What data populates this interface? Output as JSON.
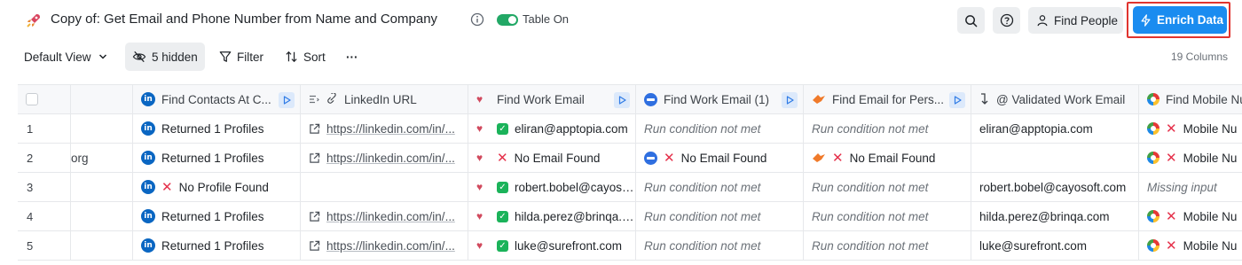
{
  "header": {
    "title": "Copy of: Get Email and Phone Number from Name and Company",
    "table_on_label": "Table On",
    "find_people_label": "Find People",
    "enrich_label": "Enrich Data"
  },
  "toolbar": {
    "view_label": "Default View",
    "hidden_label": "5 hidden",
    "filter_label": "Filter",
    "sort_label": "Sort",
    "more_label": "···",
    "column_count": "19 Columns"
  },
  "columns": [
    {
      "label": "",
      "icon": "checkbox"
    },
    {
      "label": "",
      "icon": ""
    },
    {
      "label": "Find Contacts At C...",
      "icon": "linkedin-icon"
    },
    {
      "label": "LinkedIn URL",
      "icon": "link-icon"
    },
    {
      "label": "Find Work Email",
      "icon": "heart-icon"
    },
    {
      "label": "Find Work Email (1)",
      "icon": "blue-dot-icon"
    },
    {
      "label": "Find Email for Pers...",
      "icon": "bird-icon"
    },
    {
      "label": "@ Validated Work Email",
      "icon": "return-arrow-icon"
    },
    {
      "label": "Find Mobile Nu",
      "icon": "gcolor-icon"
    }
  ],
  "rows": [
    {
      "num": "1",
      "col1": "",
      "contacts": "Returned 1 Profiles",
      "contacts_ok": true,
      "linkedin": "https://linkedin.com/in/...",
      "work_email": "eliran@apptopia.com",
      "work_email_ok": true,
      "work_email_1": "Run condition not met",
      "email_pers": "Run condition not met",
      "validated": "eliran@apptopia.com",
      "mobile": "Mobile Nu"
    },
    {
      "num": "2",
      "col1": "org",
      "contacts": "Returned 1 Profiles",
      "contacts_ok": true,
      "linkedin": "https://linkedin.com/in/...",
      "work_email": "No Email Found",
      "work_email_ok": false,
      "work_email_1": "No Email Found",
      "email_pers": "No Email Found",
      "validated": "",
      "mobile": "Mobile Nu"
    },
    {
      "num": "3",
      "col1": "",
      "contacts": "No Profile Found",
      "contacts_ok": false,
      "linkedin": "",
      "work_email": "robert.bobel@cayosoft.com",
      "work_email_ok": true,
      "work_email_1": "Run condition not met",
      "email_pers": "Run condition not met",
      "validated": "robert.bobel@cayosoft.com",
      "mobile": "Missing input"
    },
    {
      "num": "4",
      "col1": "",
      "contacts": "Returned 1 Profiles",
      "contacts_ok": true,
      "linkedin": "https://linkedin.com/in/...",
      "work_email": "hilda.perez@brinqa.com",
      "work_email_ok": true,
      "work_email_1": "Run condition not met",
      "email_pers": "Run condition not met",
      "validated": "hilda.perez@brinqa.com",
      "mobile": "Mobile Nu"
    },
    {
      "num": "5",
      "col1": "",
      "contacts": "Returned 1 Profiles",
      "contacts_ok": true,
      "linkedin": "https://linkedin.com/in/...",
      "work_email": "luke@surefront.com",
      "work_email_ok": true,
      "work_email_1": "Run condition not met",
      "email_pers": "Run condition not met",
      "validated": "luke@surefront.com",
      "mobile": "Mobile Nu"
    }
  ],
  "colors": {
    "enrich_button": "#1a8cf0",
    "highlight_outline": "#e0342f",
    "toggle_on": "#22a866",
    "success_check": "#1bb35a",
    "error_cross": "#e5304a"
  }
}
